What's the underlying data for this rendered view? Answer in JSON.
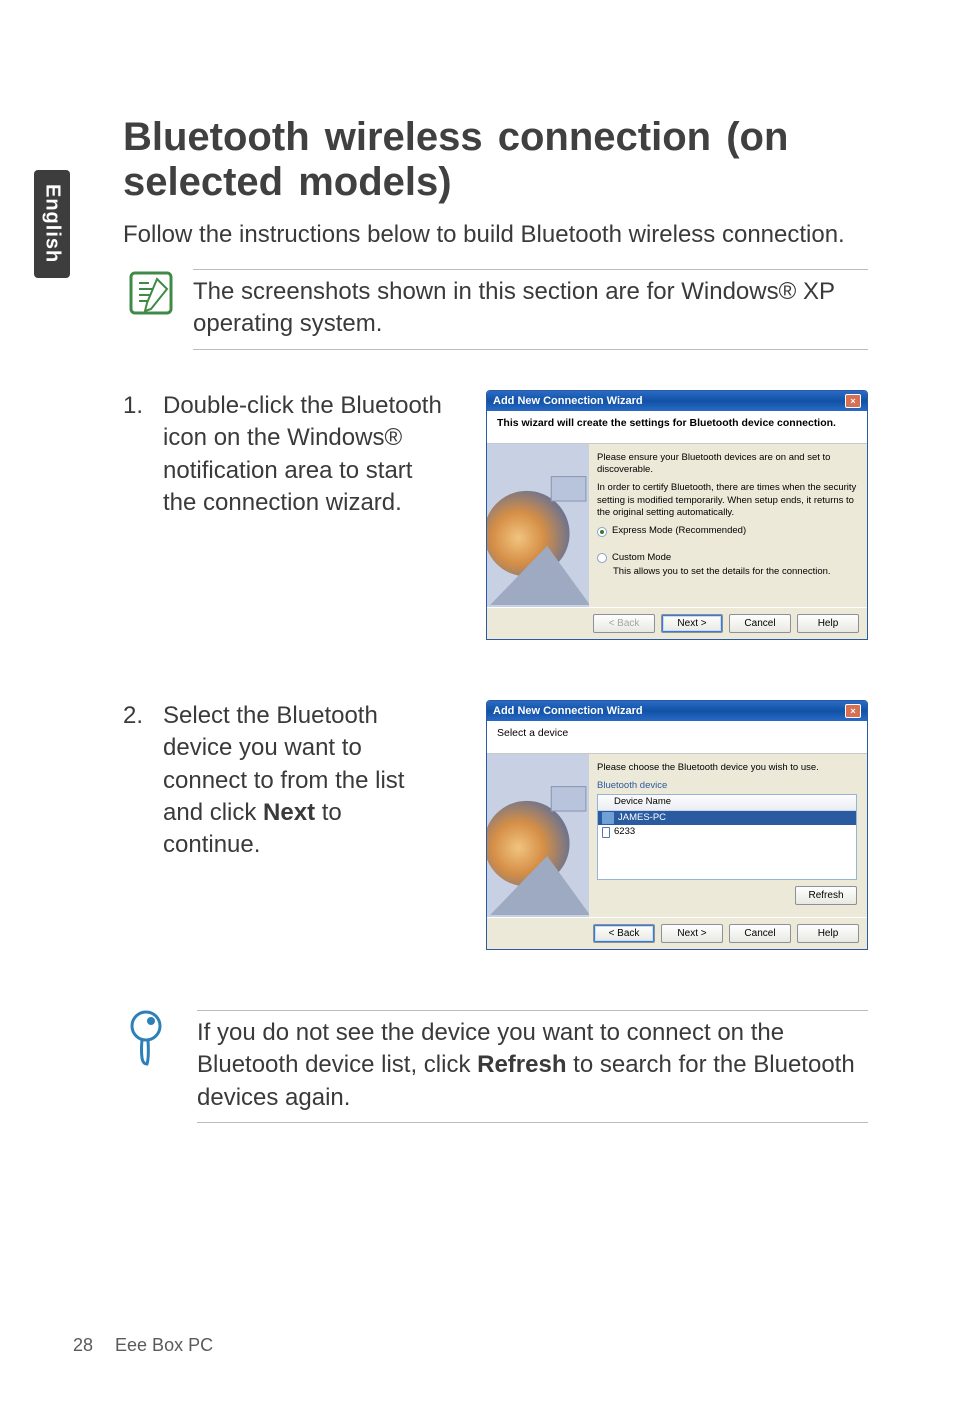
{
  "sideTab": "English",
  "title": "Bluetooth wireless connection (on selected models)",
  "intro": "Follow the instructions below to build Bluetooth wireless connection.",
  "note": "The screenshots shown in this section are for Windows® XP operating system.",
  "steps": [
    {
      "num": "1.",
      "text": "Double-click the Bluetooth icon on the Windows® notification area to start the connection wizard."
    },
    {
      "num": "2.",
      "textPrefix": "Select the Bluetooth device you want to connect to from the list and click ",
      "bold": "Next",
      "textSuffix": " to continue."
    }
  ],
  "tip": {
    "prefix": "If you do not see the device you want to connect on the Bluetooth device list, click ",
    "bold": "Refresh",
    "suffix": " to search for the Bluetooth devices again."
  },
  "wizard1": {
    "title": "Add New Connection Wizard",
    "header": "This wizard will create the settings for Bluetooth device connection.",
    "para1": "Please ensure your Bluetooth devices are on and set to discoverable.",
    "para2": "In order to certify Bluetooth, there are times when the security setting is modified temporarily. When setup ends, it returns to the original setting automatically.",
    "radio1": "Express Mode (Recommended)",
    "radio2": "Custom Mode",
    "radio2sub": "This allows you to set the details for the connection.",
    "btnBack": "< Back",
    "btnNext": "Next >",
    "btnCancel": "Cancel",
    "btnHelp": "Help"
  },
  "wizard2": {
    "title": "Add New Connection Wizard",
    "header": "Select a device",
    "prompt": "Please choose the Bluetooth device you wish to use.",
    "listLabel": "Bluetooth device",
    "colHeader": "Device Name",
    "dev1": "JAMES-PC",
    "dev2": "6233",
    "refresh": "Refresh",
    "btnBack": "< Back",
    "btnNext": "Next >",
    "btnCancel": "Cancel",
    "btnHelp": "Help"
  },
  "footer": {
    "page": "28",
    "product": "Eee Box PC"
  }
}
